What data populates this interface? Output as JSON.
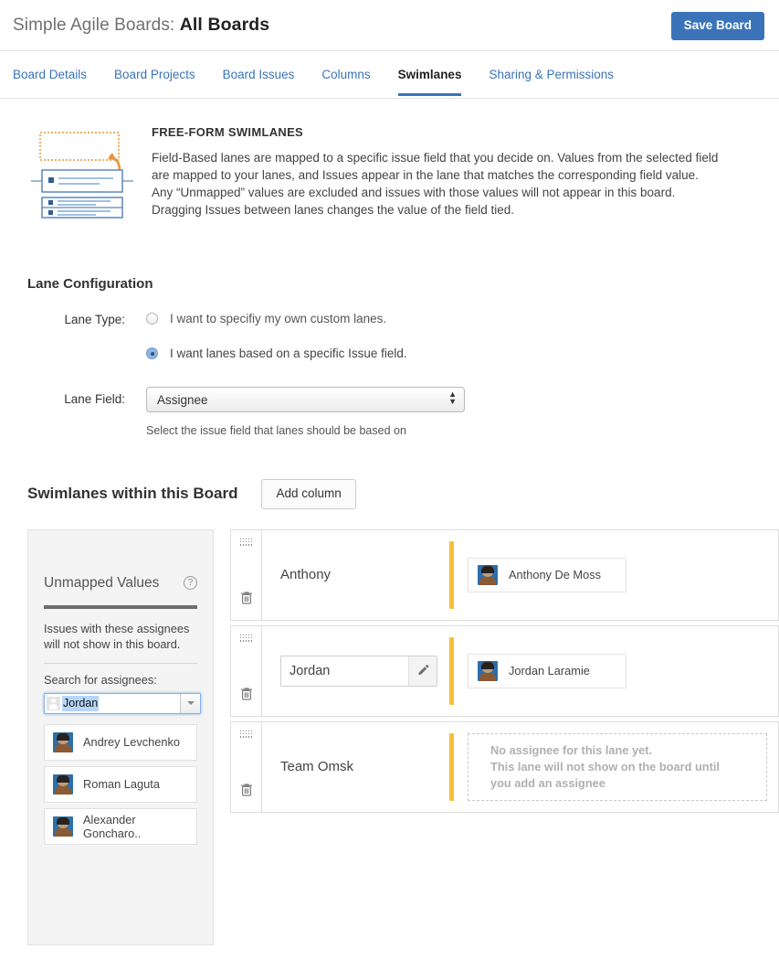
{
  "header": {
    "app_title": "Simple Agile Boards:",
    "board_name": "All Boards",
    "save_label": "Save Board"
  },
  "tabs": [
    {
      "label": "Board Details",
      "active": false
    },
    {
      "label": "Board Projects",
      "active": false
    },
    {
      "label": "Board Issues",
      "active": false
    },
    {
      "label": "Columns",
      "active": false
    },
    {
      "label": "Swimlanes",
      "active": true
    },
    {
      "label": "Sharing & Permissions",
      "active": false
    }
  ],
  "info": {
    "title": "FREE-FORM SWIMLANES",
    "line1": "Field-Based lanes are mapped to a specific issue field that you decide on. Values from the selected field",
    "line2": "are mapped to your lanes, and Issues appear in the lane that matches the corresponding field value.",
    "line3": "Any “Unmapped” values are excluded and issues with those values will not appear in this board.",
    "line4": "Dragging Issues between lanes changes the value of the field tied."
  },
  "lane_configuration": {
    "heading": "Lane Configuration",
    "lane_type_label": "Lane Type:",
    "option_custom": "I want to specifiy my own custom lanes.",
    "option_field": "I want lanes based on a specific Issue field.",
    "lane_field_label": "Lane Field:",
    "lane_field_value": "Assignee",
    "lane_field_options": [
      "Assignee"
    ],
    "lane_field_hint": "Select the issue field that lanes should be based on"
  },
  "swimlanes_section": {
    "heading": "Swimlanes within this Board",
    "add_column_label": "Add column"
  },
  "unmapped": {
    "title": "Unmapped Values",
    "help_glyph": "?",
    "note": "Issues with these assignees will not show in this board.",
    "search_label": "Search for assignees:",
    "search_value": "Jordan",
    "assignees": [
      {
        "name": "Andrey Levchenko"
      },
      {
        "name": "Roman Laguta"
      },
      {
        "name": "Alexander Goncharo.."
      }
    ]
  },
  "lanes": [
    {
      "name": "Anthony",
      "editing": false,
      "bar_color": "#f5c139",
      "chips": [
        {
          "name": "Anthony De Moss"
        }
      ],
      "empty": false
    },
    {
      "name": "Jordan",
      "editing": true,
      "bar_color": "#f5c139",
      "chips": [
        {
          "name": "Jordan Laramie"
        }
      ],
      "empty": false
    },
    {
      "name": "Team Omsk",
      "editing": false,
      "bar_color": "#f5c139",
      "chips": [],
      "empty": true,
      "empty_line1": "No assignee for this lane yet.",
      "empty_line2": "This lane will not show on the board until",
      "empty_line3": "you add an assignee"
    }
  ],
  "colors": {
    "accent_blue": "#3b73b9",
    "lane_bar": "#f5c139",
    "panel_gray": "#f4f4f4"
  }
}
